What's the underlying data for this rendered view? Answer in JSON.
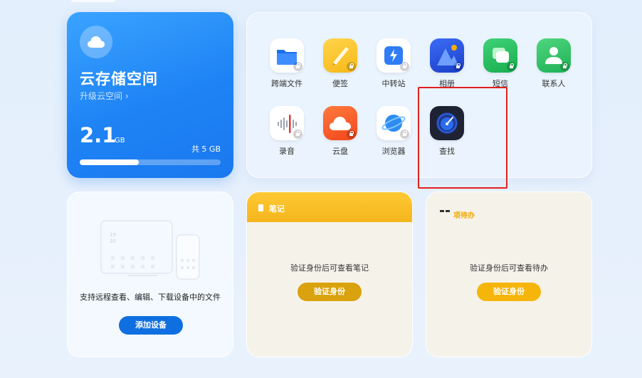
{
  "storage": {
    "title": "云存储空间",
    "upgrade": "升级云空间 ›",
    "used_value": "2.1",
    "used_unit": "GB",
    "total": "共 5 GB",
    "used_fraction": 0.42
  },
  "apps": [
    {
      "label": "跨端文件",
      "icon": "folder-icon"
    },
    {
      "label": "便签",
      "icon": "notepad-icon"
    },
    {
      "label": "中转站",
      "icon": "transfer-station-icon"
    },
    {
      "label": "相册",
      "icon": "gallery-icon"
    },
    {
      "label": "短信",
      "icon": "messages-icon"
    },
    {
      "label": "联系人",
      "icon": "contacts-icon"
    },
    {
      "label": "录音",
      "icon": "recorder-icon"
    },
    {
      "label": "云盘",
      "icon": "cloud-drive-icon"
    },
    {
      "label": "浏览器",
      "icon": "browser-icon"
    },
    {
      "label": "查找",
      "icon": "find-device-icon"
    }
  ],
  "devices": {
    "description": "支持远程查看、编辑、下载设备中的文件",
    "add_button": "添加设备",
    "illus_time": "19\n30"
  },
  "notes": {
    "title": "笔记",
    "message": "验证身份后可查看笔记",
    "verify_button": "验证身份"
  },
  "todo": {
    "title": "项待办",
    "message": "验证身份后可查看待办",
    "verify_button": "验证身份"
  },
  "colors": {
    "accent_blue": "#1e83f5",
    "notes_yellow": "#f4b51c",
    "highlight_red": "#e02020"
  }
}
